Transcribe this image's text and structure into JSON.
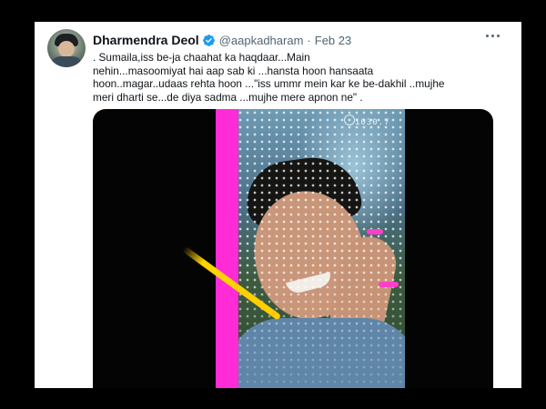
{
  "tweet": {
    "author": {
      "display_name": "Dharmendra Deol",
      "handle": "@aapkadharam",
      "verified": true
    },
    "separator": "·",
    "date": "Feb 23",
    "text_lines": [
      ".                   Sumaila,iss be-ja chaahat  ka haqdaar...Main",
      "nehin...masoomiyat hai aap sab ki ...hansta hoon hansaata",
      "hoon..magar..udaas rehta hoon ...\"iss ummr mein kar ke be-dakhil ..mujhe",
      "meri dharti se...de diya sadma ...mujhe mere apnon ne\" ."
    ],
    "media": {
      "overlay_text": "1030.7"
    }
  },
  "icons": {
    "verified": "verified-badge-icon",
    "more": "more-options-icon"
  },
  "colors": {
    "verified_blue": "#1d9bf0",
    "secondary_text": "#536471",
    "magenta": "#ff2bd6",
    "yellow": "#ffd400"
  }
}
